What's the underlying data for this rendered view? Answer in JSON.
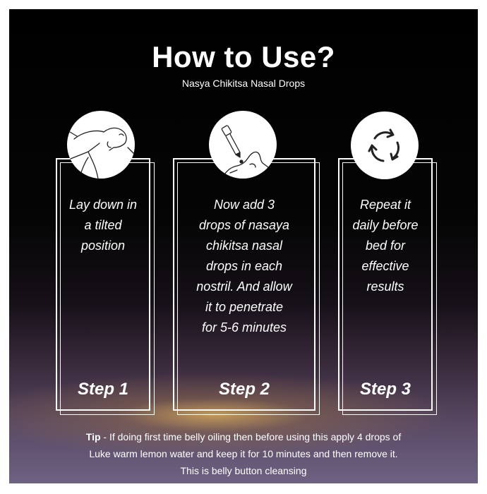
{
  "header": {
    "title": "How to Use?",
    "subtitle": "Nasya Chikitsa Nasal Drops"
  },
  "steps": [
    {
      "icon": "person-lying-tilted-icon",
      "text_lines": [
        "Lay down in",
        "a tilted",
        "position"
      ],
      "label": "Step 1"
    },
    {
      "icon": "dropper-nose-icon",
      "text_lines": [
        "Now add 3",
        "drops of nasaya",
        "chikitsa nasal",
        "drops in each",
        "nostril. And allow",
        "it to penetrate",
        "for 5-6 minutes"
      ],
      "label": "Step 2"
    },
    {
      "icon": "repeat-cycle-icon",
      "text_lines": [
        "Repeat it",
        "daily before",
        "bed for",
        "effective",
        "results"
      ],
      "label": "Step 3"
    }
  ],
  "tip": {
    "label": "Tip",
    "lines": [
      " - If doing first time belly oiling then before using this apply 4 drops of",
      "Luke warm lemon water and keep it for 10 minutes and then remove it.",
      "This is belly button cleansing"
    ]
  },
  "colors": {
    "background_top": "#000000",
    "background_bottom": "#6e6282",
    "glow": "#d6a858",
    "text": "#ffffff",
    "icon_circle": "#ffffff",
    "icon_line": "#222222"
  }
}
